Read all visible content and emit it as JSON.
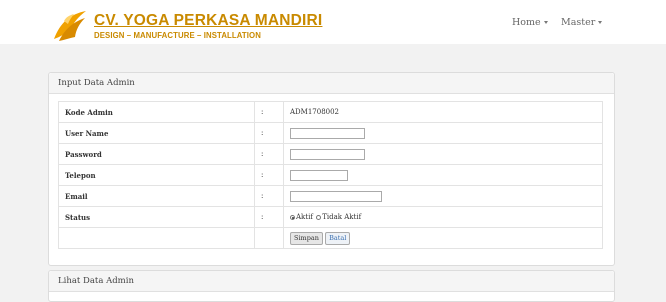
{
  "brand": {
    "title": "CV. YOGA PERKASA MANDIRI",
    "subtitle": "DESIGN – MANUFACTURE – INSTALLATION"
  },
  "nav": {
    "home": "Home",
    "master": "Master"
  },
  "panel_input": {
    "title": "Input Data Admin",
    "separator": ":",
    "rows": [
      {
        "label": "Kode Admin",
        "value": "ADM1708002"
      },
      {
        "label": "User Name"
      },
      {
        "label": "Password"
      },
      {
        "label": "Telepon"
      },
      {
        "label": "Email"
      },
      {
        "label": "Status",
        "options": [
          "Aktif",
          "Tidak Aktif"
        ],
        "selected": "Aktif"
      }
    ],
    "buttons": {
      "save": "Simpan",
      "cancel": "Batal"
    }
  },
  "panel_list": {
    "title": "Lihat Data Admin"
  },
  "colors": {
    "brand": "#c98a00",
    "accent_link": "#3a6fb0"
  }
}
